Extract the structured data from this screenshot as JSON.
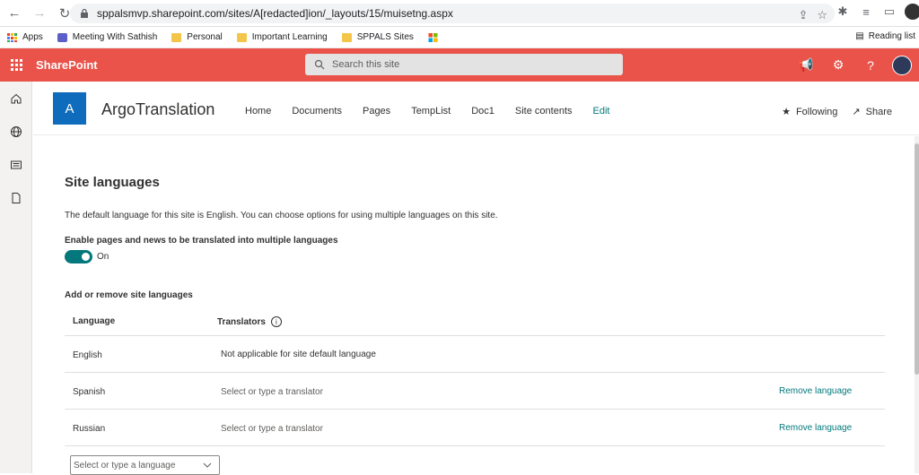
{
  "browser": {
    "url": "sppalsmvp.sharepoint.com/sites/A[redacted]ion/_layouts/15/muisetng.aspx",
    "bookmarks": [
      {
        "label": "Apps",
        "icon": "apps-grid-icon"
      },
      {
        "label": "Meeting With Sathish",
        "icon": "teams-icon"
      },
      {
        "label": "Personal",
        "icon": "folder-icon"
      },
      {
        "label": "Important Learning",
        "icon": "folder-icon"
      },
      {
        "label": "SPPALS Sites",
        "icon": "folder-icon"
      }
    ],
    "reading_list": "Reading list"
  },
  "suitebar": {
    "app_name": "SharePoint",
    "search_placeholder": "Search this site",
    "color": "#e9534a"
  },
  "site": {
    "logo_letter": "A",
    "name": "ArgoTranslation",
    "nav": [
      "Home",
      "Documents",
      "Pages",
      "TempList",
      "Doc1",
      "Site contents"
    ],
    "edit_label": "Edit",
    "following_label": "Following",
    "share_label": "Share"
  },
  "page": {
    "title": "Site languages",
    "description": "The default language for this site is English. You can choose options for using multiple languages on this site.",
    "toggle_label": "Enable pages and news to be translated into multiple languages",
    "toggle_state": "On",
    "section_label": "Add or remove site languages",
    "table": {
      "col_language": "Language",
      "col_translators": "Translators",
      "rows": [
        {
          "language": "English",
          "translators": "Not applicable for site default language",
          "remove": ""
        },
        {
          "language": "Spanish",
          "translators": "Select or type a translator",
          "remove": "Remove language"
        },
        {
          "language": "Russian",
          "translators": "Select or type a translator",
          "remove": "Remove language"
        }
      ]
    },
    "add_language_placeholder": "Select or type a language"
  },
  "colors": {
    "accent": "#03787c",
    "site_logo": "#0f6cbd"
  }
}
